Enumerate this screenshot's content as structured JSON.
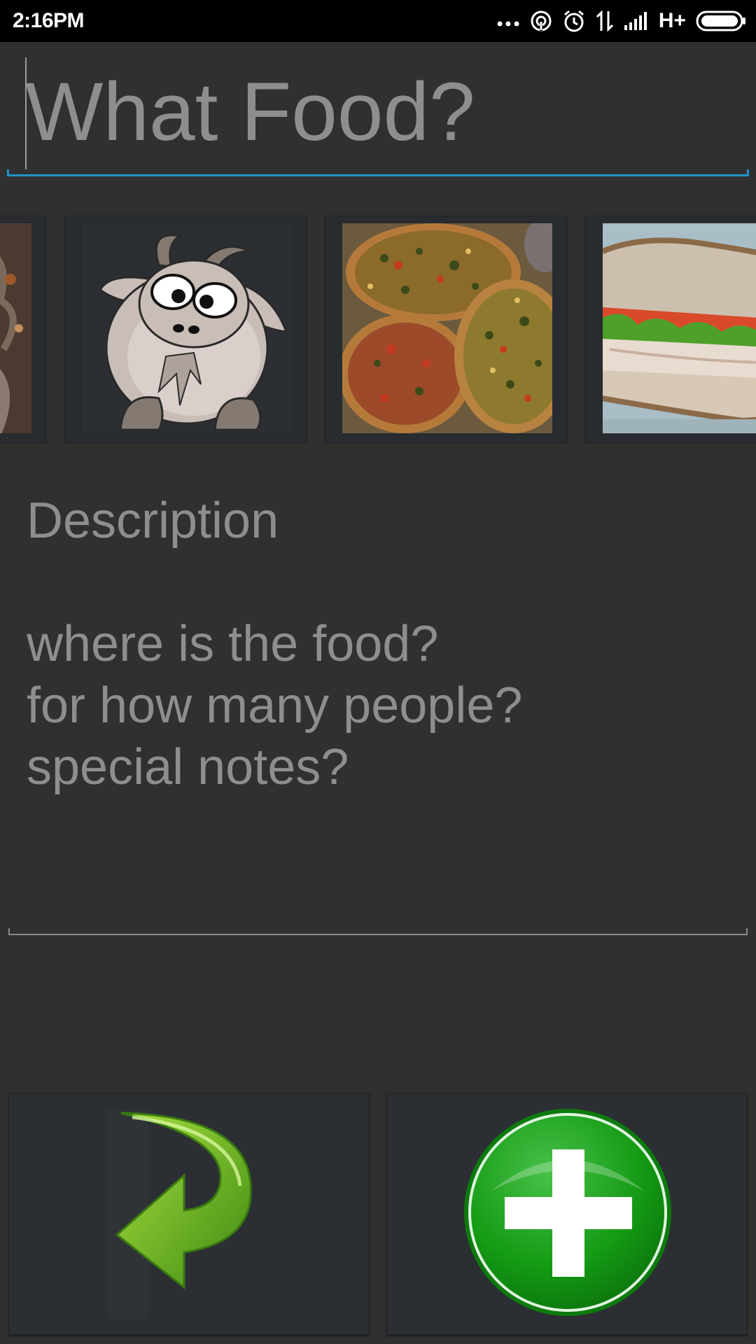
{
  "status_bar": {
    "time": "2:16PM",
    "network_type": "H+",
    "icons": [
      "more-dots-icon",
      "hotspot-icon",
      "alarm-icon",
      "data-transfer-icon",
      "signal-icon",
      "battery-icon"
    ]
  },
  "title_field": {
    "placeholder": "What Food?"
  },
  "carousel": {
    "items": [
      {
        "name": "food-photo-partial"
      },
      {
        "name": "goat-cartoon"
      },
      {
        "name": "pizzas-photo"
      },
      {
        "name": "sandwich-photo"
      }
    ]
  },
  "description_field": {
    "placeholder": "Description\n\nwhere is the food?\nfor how many people?\nspecial notes?"
  },
  "buttons": {
    "back_icon": "back-arrow-icon",
    "add_icon": "add-plus-icon",
    "add_color": "#128a12",
    "back_color": "#6cc21f"
  },
  "colors": {
    "background": "#303030",
    "accent": "#1f93c6"
  }
}
